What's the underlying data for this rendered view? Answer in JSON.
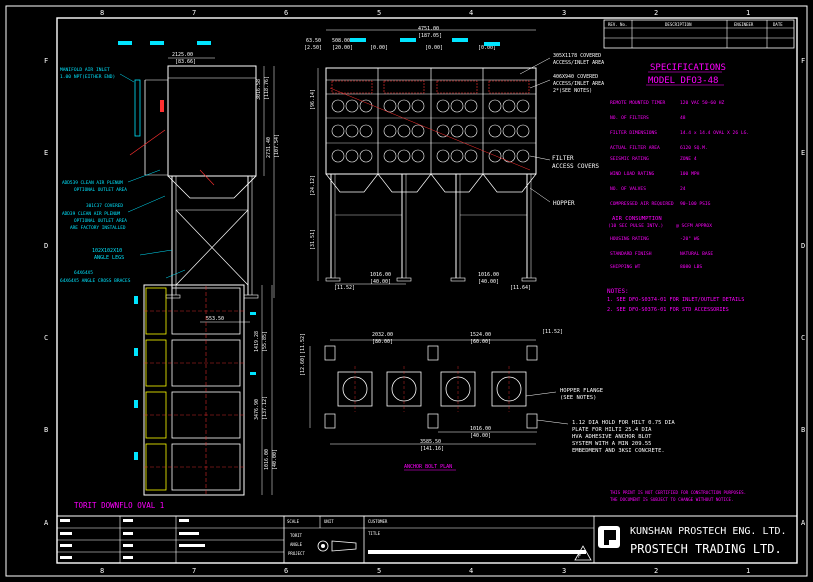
{
  "border": {
    "columns_top": [
      "8",
      "7",
      "6",
      "5",
      "4",
      "3",
      "2",
      "1"
    ],
    "columns_bottom": [
      "8",
      "7",
      "6",
      "5",
      "4",
      "3",
      "2",
      "1"
    ],
    "rows_left": [
      "F",
      "E",
      "D",
      "C",
      "B",
      "A"
    ],
    "rows_right": [
      "F",
      "E",
      "D",
      "C",
      "B",
      "A"
    ]
  },
  "revision_block": {
    "rev": "REV. No.",
    "description": "DESCRIPTION",
    "engineer": "ENGINEER",
    "date": "DATE"
  },
  "specs": {
    "heading": "SPECIFICATIONS",
    "model": "MODEL DFO3-48",
    "rows": [
      {
        "label": "REMOTE MOUNTED TIMER",
        "value": "120 VAC 50-60 HZ"
      },
      {
        "label": "NO. OF FILTERS",
        "value": "48"
      },
      {
        "label": "FILTER DIMENSIONS",
        "value": "14.4 x 14.4 OVAL X 26 LG."
      },
      {
        "label": "ACTUAL FILTER AREA",
        "value": "6120 SQ.M."
      },
      {
        "label": "SEISMIC RATING",
        "value": "ZONE 4"
      },
      {
        "label": "WIND LOAD RATING",
        "value": "100 MPH"
      },
      {
        "label": "NO. OF VALVES",
        "value": "24"
      },
      {
        "label": "COMPRESSED AIR REQUIRED",
        "value": "90-100 PSIG"
      }
    ],
    "air_consumption_line1": "AIR CONSUMPTION",
    "air_consumption_line2": "(10 SEC PULSE INTV.)",
    "air_consumption_value": "@ SCFM APPROX",
    "rows2": [
      {
        "label": "HOUSING RATING",
        "value": "-20\" WG"
      },
      {
        "label": "STANDARD FINISH",
        "value": "NATURAL BASE"
      },
      {
        "label": "SHIPPING WT",
        "value": "8080 LBS"
      }
    ]
  },
  "notes": {
    "heading": "NOTES:",
    "items": [
      "1. SEE DFO-S0374-01 FOR INLET/OUTLET DETAILS",
      "2. SEE DFO-S0376-01 FOR STD ACCESSORIES"
    ]
  },
  "warning": {
    "line1": "THIS PRINT IS NOT CERTIFIED FOR CONSTRUCTION PURPOSES.",
    "line2": "THE DOCUMENT IS SUBJECT TO CHANGE WITHOUT NOTICE."
  },
  "side_view": {
    "manifold_line1": "MANIFOLD AIR INLET",
    "manifold_line2": "1.00 NPT(EITHER END)",
    "dim_top1": "2125.00",
    "dim_top2": "[83.66]",
    "dim_right1": "3016.58",
    "dim_right2": "[118.76]",
    "dim_height1": "2731.40",
    "dim_height2": "[107.54]",
    "clean_plenum1": "ADD539 CLEAN AIR PLENUM",
    "clean_plenum2": "OPTIONAL OUTLET AREA",
    "covered": "301C37 COVERED",
    "access1": "ADD39 CLEAN AIR PLENUM",
    "access2": "OPTIONAL OUTLET AREA",
    "access3": "ARE FACTORY INSTALLED",
    "legs1": "102X102X10",
    "legs2": "ANGLE LEGS",
    "braces": "64X64X5 ANGLE CROSS BRACES",
    "dim_bottom": "553.50"
  },
  "front_view": {
    "dim_total1": "4751.00",
    "dim_total2": "[187.05]",
    "dim_left1": "63.50",
    "dim_left2": "[2.50]",
    "dim_seg1": "508.00",
    "dim_seg2": "[20.00]",
    "dim_bay": "[0.00]",
    "inlet1": "305X1178 COVERED",
    "inlet2": "ACCESS/INLET AREA",
    "covered1": "406X940 COVERED",
    "covered2": "ACCESS/INLET AREA",
    "covered3": "2*(SEE NOTES)",
    "filter1": "FILTER",
    "filter2": "ACCESS COVERS",
    "hopper": "HOPPER",
    "dim_leg1": "1016.00",
    "dim_leg2": "[40.00]",
    "dim_left_b": "[11.52]",
    "dim_right_b": "[11.64]",
    "dim_vert1": "[96.14]",
    "dim_vert2": "[24.12]",
    "dim_vert3": "[31.51]"
  },
  "plan_view": {
    "title": "TORIT DOWNFLO OVAL 1",
    "dim_a1": "3476.90",
    "dim_a2": "[137.12]",
    "dim_b1": "1419.28",
    "dim_b2": "[55.85]",
    "dim_c1": "1016.00",
    "dim_c2": "[40.00]"
  },
  "anchor_plan": {
    "title": "ANCHOR BOLT PLAN",
    "dim_top1": "2032.00",
    "dim_top2": "[80.00]",
    "dim_top3": "1524.00",
    "dim_top4": "[60.00]",
    "dim_r1": "[11.52]",
    "hopper_flange1": "HOPPER FLANGE",
    "hopper_flange2": "(SEE NOTES)",
    "anchor1": "1.12 DIA HOLD FOR HILT 0.75 DIA",
    "anchor2": "PLATE FOR HILTI 25.4 DIA",
    "anchor3": "HVA ADHESIVE ANCHOR BLOT",
    "anchor4": "SYSTEM WITH A MIN 209.55",
    "anchor5": "EMBEDMENT AND 3KSI CONCRETE.",
    "dim_bot1": "1016.00",
    "dim_bot2": "[40.00]",
    "dim_bot3": "3585.50",
    "dim_bot4": "[141.16]",
    "dim_left1": "[12.60]",
    "dim_left2": "[11.52]"
  },
  "title_block": {
    "company1": "KUNSHAN PROSTECH ENG. LTD.",
    "company2": "PROSTECH TRADING LTD.",
    "scale_label": "SCALE",
    "unit_label": "UNIT",
    "customer_label": "CUSTOMER",
    "title_label": "TITLE",
    "torit1": "TORIT",
    "torit2": "ANGLE",
    "torit3": "PROJECT",
    "f_label": "F"
  },
  "colors": {
    "background": "#000000",
    "line": "#ffffff",
    "cyan": "#00e5ff",
    "magenta": "#ff00ff",
    "red": "#ff3030",
    "yellow": "#ffff00"
  }
}
